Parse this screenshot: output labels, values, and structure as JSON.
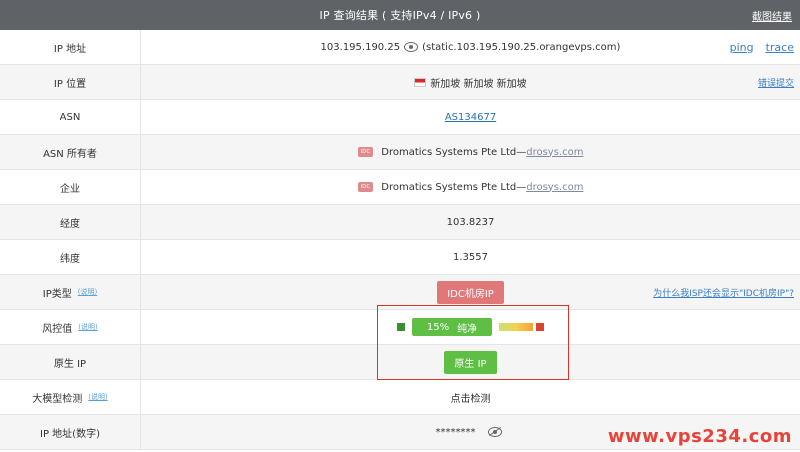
{
  "header": {
    "title": "IP 查询结果 ( 支持IPv4 / IPv6 )",
    "screenshot_link": "截图结果"
  },
  "rows": {
    "ip": {
      "label": "IP 地址",
      "value": "103.195.190.25",
      "hostname": "(static.103.195.190.25.orangevps.com)",
      "links": [
        "ping",
        "trace"
      ]
    },
    "location": {
      "label": "IP 位置",
      "value": "新加坡 新加坡 新加坡",
      "link": "错误提交"
    },
    "asn": {
      "label": "ASN",
      "value": "AS134677"
    },
    "asn_owner": {
      "label": "ASN 所有者",
      "tag": "IDC",
      "name": "Dromatics Systems Pte Ltd—",
      "domain": "drosys.com"
    },
    "company": {
      "label": "企业",
      "tag": "IDC",
      "name": "Dromatics Systems Pte Ltd—",
      "domain": "drosys.com"
    },
    "longitude": {
      "label": "经度",
      "value": "103.8237"
    },
    "latitude": {
      "label": "纬度",
      "value": "1.3557"
    },
    "ip_type": {
      "label": "IP类型",
      "note": "(说明)",
      "value": "IDC机房IP",
      "link": "为什么我ISP还会显示\"IDC机房IP\"?"
    },
    "risk": {
      "label": "风控值",
      "note": "(说明)",
      "percent": "15%",
      "status": "纯净"
    },
    "native_ip": {
      "label": "原生 IP",
      "value": "原生 IP"
    },
    "llm_check": {
      "label": "大模型检测",
      "note": "(说明)",
      "link": "点击检测"
    },
    "ip_numeric": {
      "label": "IP 地址(数字)",
      "value": "********"
    }
  },
  "watermark": "www.vps234.com",
  "colors": {
    "header_bg": "#5f6368",
    "link": "#3a7fc4",
    "red_badge": "#e0787a",
    "green_badge": "#5fbf45",
    "highlight": "#d9342b",
    "watermark": "#e8433a"
  }
}
